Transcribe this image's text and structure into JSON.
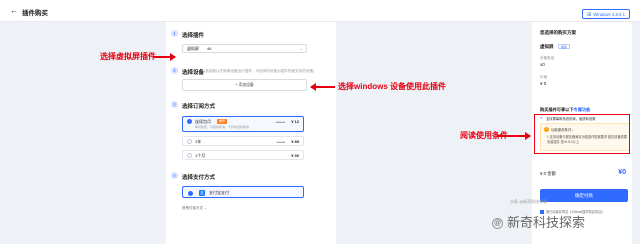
{
  "header": {
    "back_icon": "arrow-left-icon",
    "title": "插件购买",
    "version": "Windows 4.8.0.1"
  },
  "steps": [
    {
      "number": "1",
      "title": "选择插件"
    },
    {
      "number": "2",
      "title": "选择设备",
      "hint": "(将会默认在新增设备运行插件，可选择的设备为插件所能支持的设备)"
    },
    {
      "number": "3",
      "title": "选择订阅方式"
    },
    {
      "number": "4",
      "title": "选择支付方式"
    }
  ],
  "plugin_select": {
    "value": "虚拟屏",
    "value2": "4K",
    "chevron": "chevron-down-icon"
  },
  "add_device": "+ 添加设备",
  "plans": [
    {
      "name": "连续包月",
      "badge": "推荐",
      "sub": "每月续费，可随时取消，不影响当前使用",
      "old_price": "¥99.00",
      "price": "¥ 12"
    },
    {
      "name": "1年",
      "old_price": "¥ 9.00",
      "price": "¥ 85"
    },
    {
      "name": "1个月",
      "price": "¥ 30"
    }
  ],
  "payment": {
    "label": "支付宝支付",
    "icon": "alipay-icon"
  },
  "more_payment": "其他付费方式 ⌄",
  "summary": {
    "title": "您选择的购买方案",
    "plugin_name": "虚拟屏",
    "plugin_tag": "插件",
    "devices_label": "设备数量",
    "devices_value": "x0",
    "price_label": "价格",
    "price_value": "¥ 0",
    "section_title": "购买插件可享以下",
    "section_link": "专属功能",
    "checklist_item": "支持屏幕和系统布局，画质和设置",
    "notice_title": "功能使用条件：",
    "notice_body": "1.支持设备与服务器满足功能操作配置要求 被控设备需要安装插件 是v4.8.0以上",
    "total_label": "¥ 0 金额",
    "total": "¥0",
    "pay_button": "确定付款",
    "agree_text": "我已阅读并同意《ToDesk插件购买协议》"
  },
  "annotations": {
    "a1": "选择虚拟屏插件",
    "a2": "选择windows 设备使用此插件",
    "a3": "阅读使用条件"
  },
  "watermark": "新奇科技探索",
  "watermark_sub": "头条 @新奇科技探索",
  "colors": {
    "accent": "#2f6bff",
    "annotation": "#e60012",
    "badge": "#ff7d1a"
  }
}
